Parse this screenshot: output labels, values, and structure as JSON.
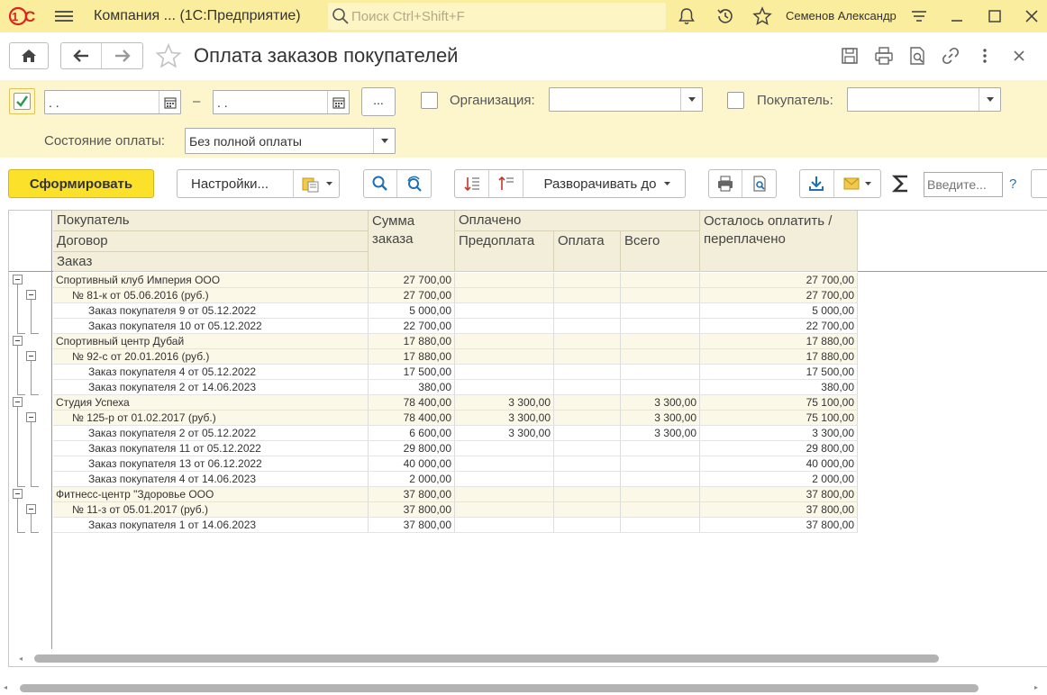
{
  "app": {
    "title": "Компания ...  (1С:Предприятие)",
    "search_placeholder": "Поиск Ctrl+Shift+F",
    "user": "Семенов Александр"
  },
  "form": {
    "title": "Оплата заказов покупателей"
  },
  "filters": {
    "period_enabled": true,
    "date_from": " .  .",
    "date_to": " .  .",
    "period_dash": "–",
    "period_button": "...",
    "org_label": "Организация:",
    "org_value": "",
    "buyer_label": "Покупатель:",
    "buyer_value": "",
    "payment_state_label": "Состояние оплаты:",
    "payment_state_value": "Без полной оплаты"
  },
  "toolbar": {
    "generate": "Сформировать",
    "settings": "Настройки...",
    "expand_to": "Разворачивать до",
    "quick_input_placeholder": "Введите...",
    "help": "?"
  },
  "report": {
    "headers": {
      "buyer": "Покупатель",
      "contract": "Договор",
      "order": "Заказ",
      "order_sum_1": "Сумма",
      "order_sum_2": "заказа",
      "paid": "Оплачено",
      "prepayment": "Предоплата",
      "payment": "Оплата",
      "total": "Всего",
      "remaining_1": "Осталось оплатить /",
      "remaining_2": "переплачено"
    },
    "rows": [
      {
        "level": 0,
        "name": "Спортивный клуб Империя ООО",
        "sum": "27 700,00",
        "pre": "",
        "pay": "",
        "total": "",
        "rest": "27 700,00"
      },
      {
        "level": 1,
        "name": "№ 81-к от 05.06.2016 (руб.)",
        "sum": "27 700,00",
        "pre": "",
        "pay": "",
        "total": "",
        "rest": "27 700,00"
      },
      {
        "level": 2,
        "name": "Заказ покупателя 9 от 05.12.2022",
        "sum": "5 000,00",
        "pre": "",
        "pay": "",
        "total": "",
        "rest": "5 000,00"
      },
      {
        "level": 2,
        "name": "Заказ покупателя 10 от 05.12.2022",
        "sum": "22 700,00",
        "pre": "",
        "pay": "",
        "total": "",
        "rest": "22 700,00"
      },
      {
        "level": 0,
        "name": "Спортивный центр Дубай",
        "sum": "17 880,00",
        "pre": "",
        "pay": "",
        "total": "",
        "rest": "17 880,00"
      },
      {
        "level": 1,
        "name": "№ 92-с от 20.01.2016 (руб.)",
        "sum": "17 880,00",
        "pre": "",
        "pay": "",
        "total": "",
        "rest": "17 880,00"
      },
      {
        "level": 2,
        "name": "Заказ покупателя 4 от 05.12.2022",
        "sum": "17 500,00",
        "pre": "",
        "pay": "",
        "total": "",
        "rest": "17 500,00"
      },
      {
        "level": 2,
        "name": "Заказ покупателя 2 от 14.06.2023",
        "sum": "380,00",
        "pre": "",
        "pay": "",
        "total": "",
        "rest": "380,00"
      },
      {
        "level": 0,
        "name": "Студия Успеха",
        "sum": "78 400,00",
        "pre": "3 300,00",
        "pay": "",
        "total": "3 300,00",
        "rest": "75 100,00"
      },
      {
        "level": 1,
        "name": "№ 125-р от 01.02.2017 (руб.)",
        "sum": "78 400,00",
        "pre": "3 300,00",
        "pay": "",
        "total": "3 300,00",
        "rest": "75 100,00"
      },
      {
        "level": 2,
        "name": "Заказ покупателя 2 от 05.12.2022",
        "sum": "6 600,00",
        "pre": "3 300,00",
        "pay": "",
        "total": "3 300,00",
        "rest": "3 300,00"
      },
      {
        "level": 2,
        "name": "Заказ покупателя 11 от 05.12.2022",
        "sum": "29 800,00",
        "pre": "",
        "pay": "",
        "total": "",
        "rest": "29 800,00"
      },
      {
        "level": 2,
        "name": "Заказ покупателя 13 от 06.12.2022",
        "sum": "40 000,00",
        "pre": "",
        "pay": "",
        "total": "",
        "rest": "40 000,00"
      },
      {
        "level": 2,
        "name": "Заказ покупателя 4 от 14.06.2023",
        "sum": "2 000,00",
        "pre": "",
        "pay": "",
        "total": "",
        "rest": "2 000,00"
      },
      {
        "level": 0,
        "name": "Фитнесс-центр \"Здоровье ООО",
        "sum": "37 800,00",
        "pre": "",
        "pay": "",
        "total": "",
        "rest": "37 800,00"
      },
      {
        "level": 1,
        "name": "№ 11-з от 05.01.2017 (руб.)",
        "sum": "37 800,00",
        "pre": "",
        "pay": "",
        "total": "",
        "rest": "37 800,00"
      },
      {
        "level": 2,
        "name": "Заказ покупателя 1 от 14.06.2023",
        "sum": "37 800,00",
        "pre": "",
        "pay": "",
        "total": "",
        "rest": "37 800,00"
      }
    ]
  },
  "colors": {
    "appbar": "#fbed9e",
    "filter_panel": "#fdf6cc",
    "primary_button": "#fbe12a",
    "header_cells": "#f2eed9",
    "group_rows": "#fbf8e8"
  }
}
